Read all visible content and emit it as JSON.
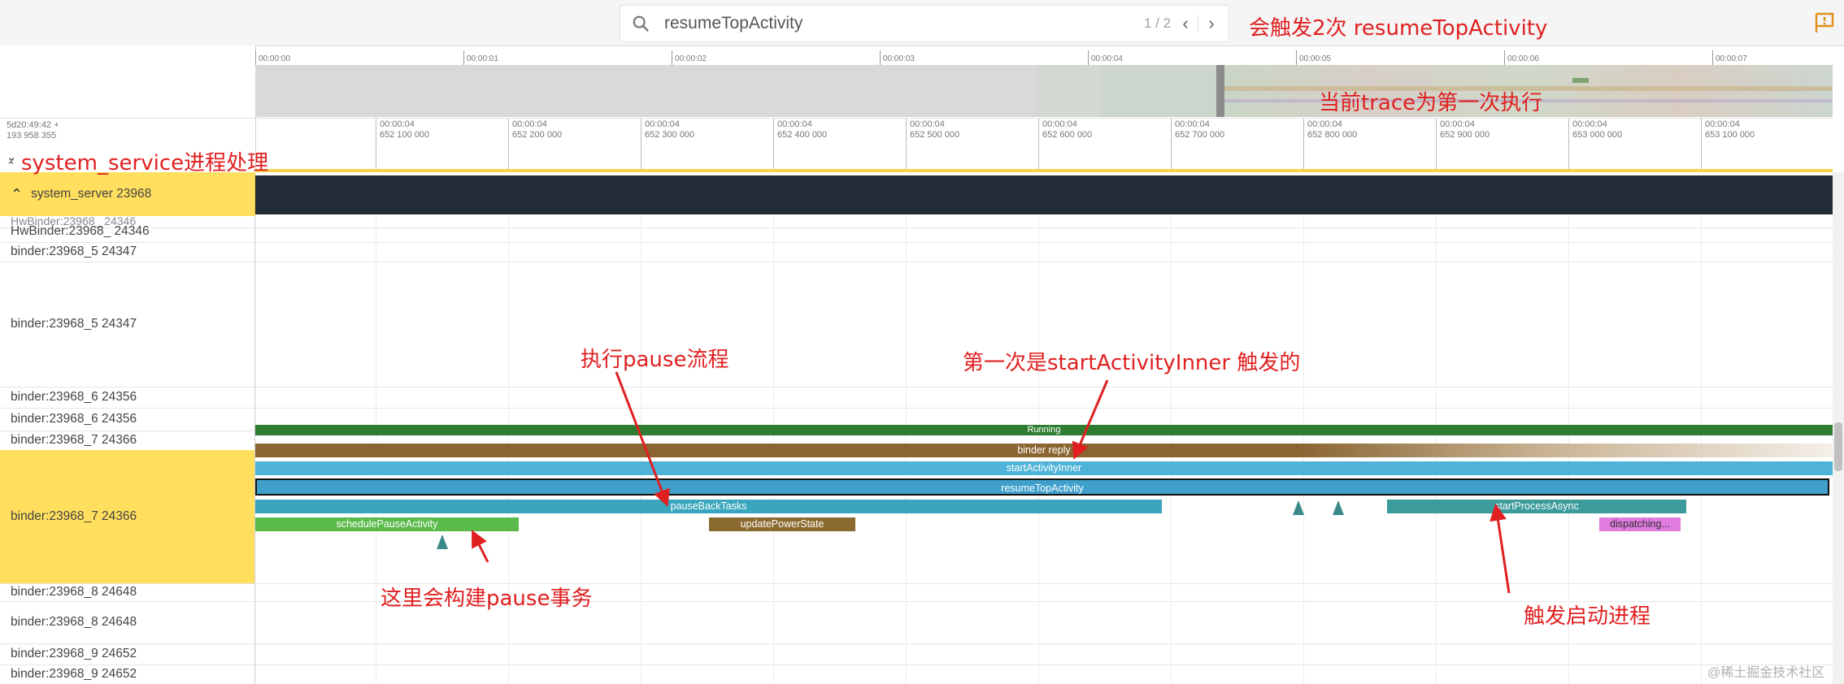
{
  "search": {
    "value": "resumeTopActivity",
    "count": "1 / 2",
    "prev": "‹",
    "next": "›"
  },
  "overview": {
    "ticks": [
      "00:00:00",
      "00:00:01",
      "00:00:02",
      "00:00:03",
      "00:00:04",
      "00:00:05",
      "00:00:06",
      "00:00:07"
    ]
  },
  "detail": {
    "offset_line1": "5d20:49:42 +",
    "offset_line2": "193 958 355",
    "ticks": [
      {
        "a": "00:00:04",
        "b": "652 100 000"
      },
      {
        "a": "00:00:04",
        "b": "652 200 000"
      },
      {
        "a": "00:00:04",
        "b": "652 300 000"
      },
      {
        "a": "00:00:04",
        "b": "652 400 000"
      },
      {
        "a": "00:00:04",
        "b": "652 500 000"
      },
      {
        "a": "00:00:04",
        "b": "652 600 000"
      },
      {
        "a": "00:00:04",
        "b": "652 700 000"
      },
      {
        "a": "00:00:04",
        "b": "652 800 000"
      },
      {
        "a": "00:00:04",
        "b": "652 900 000"
      },
      {
        "a": "00:00:04",
        "b": "653 000 000"
      },
      {
        "a": "00:00:04",
        "b": "653 100 000"
      }
    ]
  },
  "process": {
    "label": "system_server 23968"
  },
  "tracks": {
    "partial_top": "HwBinder:23968_ 24346",
    "r1": "HwBinder:23968_ 24346",
    "r2": "binder:23968_5 24347",
    "r3": "binder:23968_5 24347",
    "r4": "binder:23968_6 24356",
    "r5": "binder:23968_6 24356",
    "r6": "binder:23968_7 24366",
    "r7": "binder:23968_7 24366",
    "r8": "binder:23968_8 24648",
    "r9": "binder:23968_8 24648",
    "r10": "binder:23968_9 24652",
    "r11": "binder:23968_9 24652"
  },
  "slices": {
    "running": "Running",
    "binder_reply": "binder reply",
    "start_activity_inner": "startActivityInner",
    "resume_top_activity": "resumeTopActivity",
    "pause_back_tasks": "pauseBackTasks",
    "schedule_pause_activity": "schedulePauseActivity",
    "update_power_state": "updatePowerState",
    "start_process_async": "startProcessAsync",
    "dispatching": "dispatching..."
  },
  "annotations": {
    "trigger_twice": "会触发2次 resumeTopActivity",
    "current_trace": "当前trace为第一次执行",
    "system_service": "system_service进程处理",
    "exec_pause": "执行pause流程",
    "first_time": "第一次是startActivityInner 触发的",
    "build_pause": "这里会构建pause事务",
    "trigger_start": "触发启动进程"
  },
  "watermark": "@稀土掘金技术社区",
  "colors": {
    "running": "#2f7d32",
    "binder_reply": "#8a6532",
    "slice_blue": "#4fb3d9",
    "pause_back": "#3aa6bd",
    "schedule_pause": "#5aba4a",
    "update_power": "#8b6a2f",
    "start_process": "#3c9b9b",
    "dispatching": "#e07be0",
    "selection": "#ffdf5d",
    "annotation": "#e02020"
  },
  "icons": [
    "search-icon",
    "chevron-left-icon",
    "chevron-right-icon",
    "flag-icon",
    "collapse-icon",
    "expand-icon"
  ]
}
